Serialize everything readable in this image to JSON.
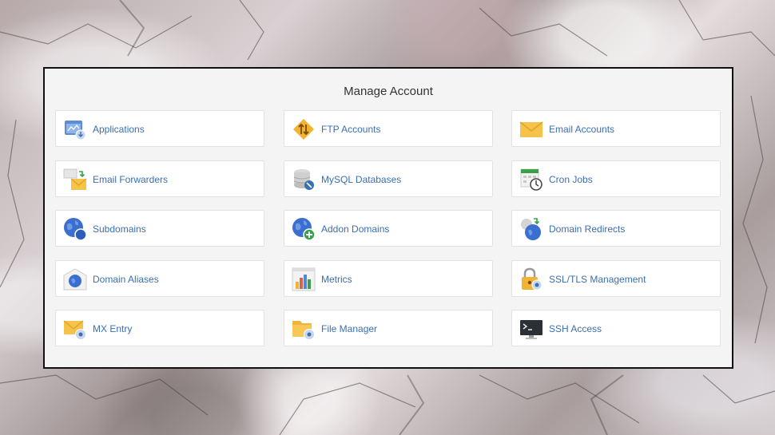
{
  "panel": {
    "title": "Manage Account"
  },
  "tiles": [
    {
      "label": "Applications",
      "icon": "applications-icon"
    },
    {
      "label": "FTP Accounts",
      "icon": "ftp-icon"
    },
    {
      "label": "Email Accounts",
      "icon": "email-icon"
    },
    {
      "label": "Email Forwarders",
      "icon": "email-forwarder-icon"
    },
    {
      "label": "MySQL Databases",
      "icon": "database-icon"
    },
    {
      "label": "Cron Jobs",
      "icon": "cron-clock-icon"
    },
    {
      "label": "Subdomains",
      "icon": "globe-icon"
    },
    {
      "label": "Addon Domains",
      "icon": "globe-add-icon"
    },
    {
      "label": "Domain Redirects",
      "icon": "globe-redirect-icon"
    },
    {
      "label": "Domain Aliases",
      "icon": "domain-alias-icon"
    },
    {
      "label": "Metrics",
      "icon": "metrics-chart-icon"
    },
    {
      "label": "SSL/TLS Management",
      "icon": "lock-icon"
    },
    {
      "label": "MX Entry",
      "icon": "mx-entry-icon"
    },
    {
      "label": "File Manager",
      "icon": "folder-icon"
    },
    {
      "label": "SSH Access",
      "icon": "terminal-icon"
    }
  ],
  "colors": {
    "label_link": "#3a6fb0",
    "panel_bg": "#f4f4f4",
    "panel_border": "#111111"
  }
}
